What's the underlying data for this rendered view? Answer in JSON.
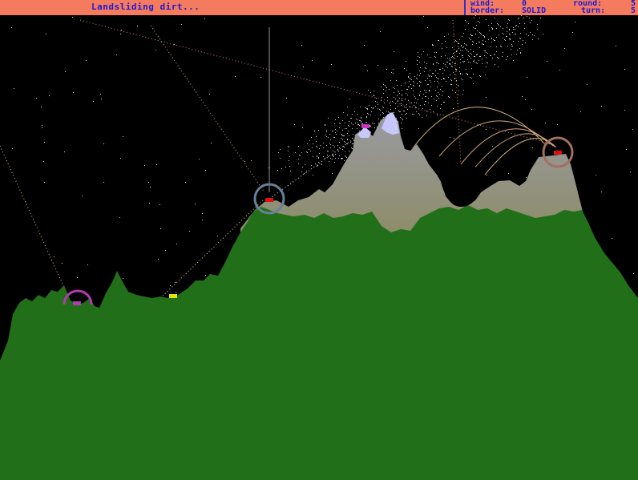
{
  "status": {
    "message": "Landsliding dirt..."
  },
  "stats": {
    "wind_label": "wind:",
    "wind_value": "0",
    "round_label": "round:",
    "round_value": "5",
    "border_label": "border:",
    "border_value": "SOLID",
    "turn_label": "turn:",
    "turn_value": "5"
  },
  "players": [
    {
      "id": "purple-tank",
      "color": "#b23bb0",
      "shield": true
    },
    {
      "id": "yellow-tank",
      "color": "#e8e000",
      "shield": false
    },
    {
      "id": "red-tank-center",
      "color": "#e01010",
      "shield": true,
      "shield_color": "#6a7f9a"
    },
    {
      "id": "magenta-tank-peak",
      "color": "#d030c0",
      "shield": false
    },
    {
      "id": "red-tank-right",
      "color": "#e01010",
      "shield": true,
      "shield_color": "#a07060"
    }
  ],
  "colors": {
    "sky": "#000000",
    "ground": "#226f1a",
    "rock_top": "#9a9aa0",
    "rock_bottom": "#8a8a6a",
    "snow": "#c8c8ff",
    "status_bar": "#f47b5e",
    "status_text": "#1a1ad8"
  }
}
